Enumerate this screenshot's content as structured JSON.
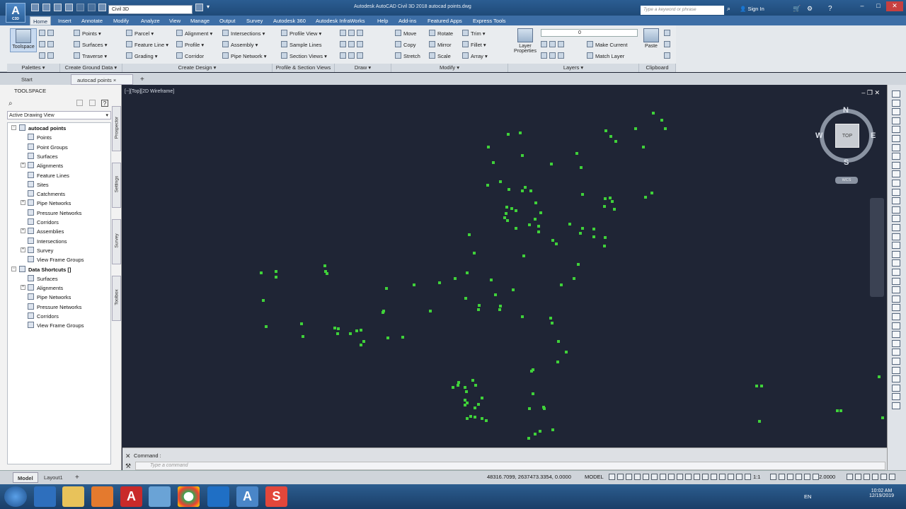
{
  "titlebar": {
    "app_glyph": "A",
    "app_sub": "C3D",
    "workspace": "Civil 3D",
    "window_title": "Autodesk AutoCAD Civil 3D 2018     autocad points.dwg",
    "search_placeholder": "Type a keyword or phrase",
    "signin": "Sign In",
    "min": "–",
    "max": "□",
    "close": "✕"
  },
  "tabs": [
    "Home",
    "Insert",
    "Annotate",
    "Modify",
    "Analyze",
    "View",
    "Manage",
    "Output",
    "Survey",
    "Autodesk 360",
    "Autodesk InfraWorks",
    "Help",
    "Add-ins",
    "Featured Apps",
    "Express Tools"
  ],
  "ribbon": {
    "toolspace_label": "Toolspace",
    "ground_data": [
      "Points",
      "Surfaces",
      "Traverse"
    ],
    "design_col1": [
      "Parcel",
      "Feature Line",
      "Grading"
    ],
    "design_col2": [
      "Alignment",
      "Profile",
      "Corridor"
    ],
    "design_col3": [
      "Intersections",
      "Assembly",
      "Pipe Network"
    ],
    "profile_section": [
      "Profile View",
      "Sample Lines",
      "Section Views"
    ],
    "modify_col1": [
      "Move",
      "Copy",
      "Stretch"
    ],
    "modify_col2": [
      "Rotate",
      "Mirror",
      "Scale"
    ],
    "modify_col3": [
      "Trim",
      "Fillet",
      "Array"
    ],
    "layer_props": "Layer Properties",
    "layer_value": "0",
    "make_current": "Make Current",
    "match_layer": "Match Layer",
    "paste": "Paste",
    "panels": [
      "Palettes",
      "Create Ground Data",
      "Create Design",
      "Profile & Section Views",
      "Draw",
      "Modify",
      "Layers",
      "Clipboard"
    ]
  },
  "file_tabs": {
    "start": "Start",
    "current": "autocad points",
    "close": "×",
    "new": "+"
  },
  "toolspace": {
    "title": "TOOLSPACE",
    "view": "Active Drawing View",
    "side_tabs": [
      "Prospector",
      "Settings",
      "Survey",
      "Toolbox"
    ],
    "tree": [
      {
        "label": "autocad points",
        "level": 0,
        "exp": "−"
      },
      {
        "label": "Points",
        "level": 1
      },
      {
        "label": "Point Groups",
        "level": 1
      },
      {
        "label": "Surfaces",
        "level": 1
      },
      {
        "label": "Alignments",
        "level": 1,
        "exp": "+"
      },
      {
        "label": "Feature Lines",
        "level": 1
      },
      {
        "label": "Sites",
        "level": 1
      },
      {
        "label": "Catchments",
        "level": 1
      },
      {
        "label": "Pipe Networks",
        "level": 1,
        "exp": "+"
      },
      {
        "label": "Pressure Networks",
        "level": 1
      },
      {
        "label": "Corridors",
        "level": 1
      },
      {
        "label": "Assemblies",
        "level": 1,
        "exp": "+"
      },
      {
        "label": "Intersections",
        "level": 1
      },
      {
        "label": "Survey",
        "level": 1,
        "exp": "+"
      },
      {
        "label": "View Frame Groups",
        "level": 1
      },
      {
        "label": "Data Shortcuts []",
        "level": 0,
        "exp": "−"
      },
      {
        "label": "Surfaces",
        "level": 1
      },
      {
        "label": "Alignments",
        "level": 1,
        "exp": "+"
      },
      {
        "label": "Pipe Networks",
        "level": 1
      },
      {
        "label": "Pressure Networks",
        "level": 1
      },
      {
        "label": "Corridors",
        "level": 1
      },
      {
        "label": "View Frame Groups",
        "level": 1
      }
    ]
  },
  "viewport": {
    "label": "[−][Top][2D Wireframe]",
    "controls": "‒ ❐ ✕",
    "point_color": "#3fd13a",
    "background": "#1f2535",
    "viewcube": {
      "n": "N",
      "s": "S",
      "e": "E",
      "w": "W",
      "top": "TOP",
      "wcs": "WCS"
    }
  },
  "command": {
    "label": "Command :",
    "placeholder": "Type a command"
  },
  "status": {
    "layout_tabs": [
      "Model",
      "Layout1"
    ],
    "coords": "48316.7099, 2637473.3354, 0.0000",
    "model": "MODEL",
    "scale": "1:1",
    "elevation": "42.0000"
  },
  "taskbar": {
    "lang": "EN",
    "time": "10:02 AM",
    "date": "12/19/2019"
  }
}
